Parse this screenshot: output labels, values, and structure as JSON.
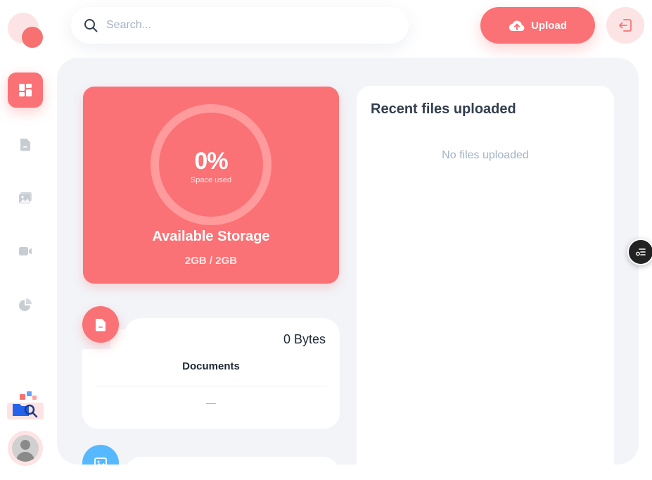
{
  "header": {
    "search_placeholder": "Search...",
    "upload_label": "Upload"
  },
  "sidebar": {
    "items": [
      {
        "icon": "dashboard-icon",
        "active": true
      },
      {
        "icon": "documents-icon",
        "active": false
      },
      {
        "icon": "images-icon",
        "active": false
      },
      {
        "icon": "video-icon",
        "active": false
      },
      {
        "icon": "others-icon",
        "active": false
      }
    ]
  },
  "storage": {
    "percent_text": "0%",
    "percent_value": 0,
    "percent_label": "Space used",
    "title": "Available Storage",
    "usage": "2GB / 2GB"
  },
  "categories": [
    {
      "name": "Documents",
      "size": "0 Bytes",
      "last_update": "—",
      "icon": "documents-icon",
      "color": "#fa7275"
    },
    {
      "name": "",
      "size": "",
      "last_update": "",
      "icon": "images-icon",
      "color": "#56b8ff"
    }
  ],
  "recent": {
    "title": "Recent files uploaded",
    "empty_text": "No files uploaded"
  },
  "colors": {
    "brand": "#fa7275",
    "brand_light": "#fde4e4",
    "panel_bg": "#f2f4f8",
    "muted_text": "#a3b2c7",
    "images_accent": "#56b8ff"
  }
}
